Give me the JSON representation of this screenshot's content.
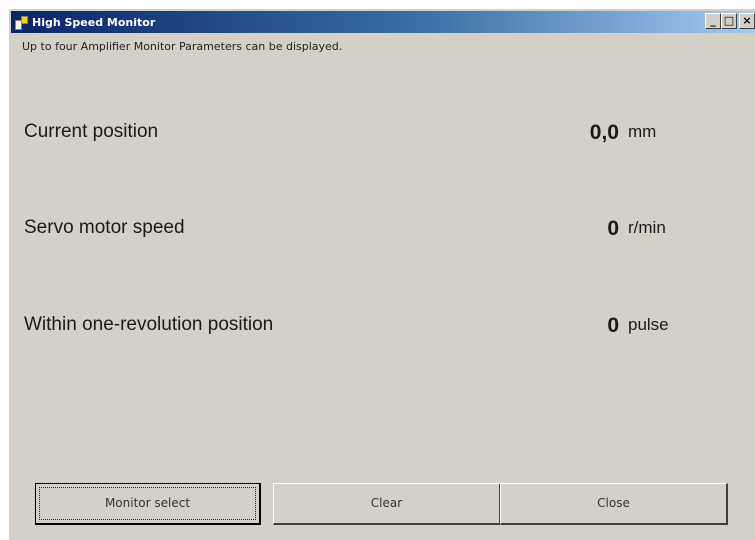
{
  "window": {
    "title": "High Speed Monitor",
    "controls": [
      "_",
      "□",
      "×"
    ]
  },
  "subtitle": "Up to four Amplifier Monitor Parameters can be displayed.",
  "monitors": [
    {
      "label": "Current position",
      "value": "0,0",
      "unit": "mm"
    },
    {
      "label": "Servo motor speed",
      "value": "0",
      "unit": "r/min"
    },
    {
      "label": "Within one-revolution position",
      "value": "0",
      "unit": "pulse"
    }
  ],
  "buttons": {
    "monitor_select": "Monitor select",
    "clear": "Clear",
    "close": "Close"
  }
}
